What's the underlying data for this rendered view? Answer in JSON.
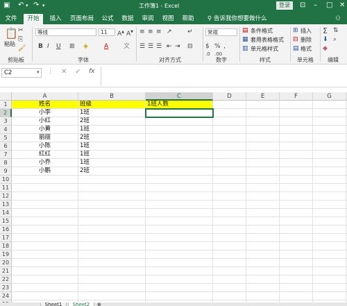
{
  "title_bar": {
    "title": "工作簿1 - Excel",
    "login_label": "登录",
    "quick_access": [
      "save-icon",
      "undo-icon",
      "redo-icon",
      "customize-icon"
    ]
  },
  "ribbon_tabs": [
    "文件",
    "开始",
    "插入",
    "页面布局",
    "公式",
    "数据",
    "审阅",
    "视图",
    "帮助"
  ],
  "active_tab": "开始",
  "tell_me": "告诉我你想要做什么",
  "ribbon": {
    "clipboard": {
      "paste": "粘贴",
      "group": "剪贴板"
    },
    "font": {
      "name": "等线",
      "size": "11",
      "group": "字体",
      "bold": "B",
      "italic": "I",
      "underline": "U"
    },
    "alignment": {
      "group": "对齐方式"
    },
    "number": {
      "format": "常规",
      "group": "数字",
      "percent": "%"
    },
    "styles": {
      "conditional": "条件格式",
      "table": "套用表格格式",
      "cell_styles": "单元格样式",
      "group": "样式"
    },
    "cells": {
      "insert": "插入",
      "delete": "删除",
      "format": "格式",
      "group": "单元格"
    },
    "editing": {
      "group": "编辑"
    }
  },
  "formula_bar": {
    "name_box": "C2",
    "formula": "",
    "fx": "fx"
  },
  "columns": [
    "A",
    "B",
    "C",
    "D",
    "E",
    "F",
    "G",
    "H"
  ],
  "selected_column": "C",
  "selected_row": 2,
  "rows": [
    1,
    2,
    3,
    4,
    5,
    6,
    7,
    8,
    9,
    10,
    11,
    12,
    13,
    14,
    15,
    16,
    17,
    18,
    19,
    20,
    21,
    22,
    23,
    24,
    25
  ],
  "cells": {
    "A1": "姓名",
    "B1": "班级",
    "C1": "1班人数",
    "A2": "小李",
    "B2": "1班",
    "A3": "小红",
    "B3": "2班",
    "A4": "小黄",
    "B4": "1班",
    "A5": "丽丽",
    "B5": "2班",
    "A6": "小陈",
    "B6": "1班",
    "A7": "红红",
    "B7": "1班",
    "A8": "小乔",
    "B8": "1班",
    "A9": "小鹏",
    "B9": "2班"
  },
  "sheet_tabs": [
    "Sheet1",
    "Sheet2"
  ],
  "colors": {
    "excel_green": "#217346",
    "header_fill": "#ffff00"
  }
}
